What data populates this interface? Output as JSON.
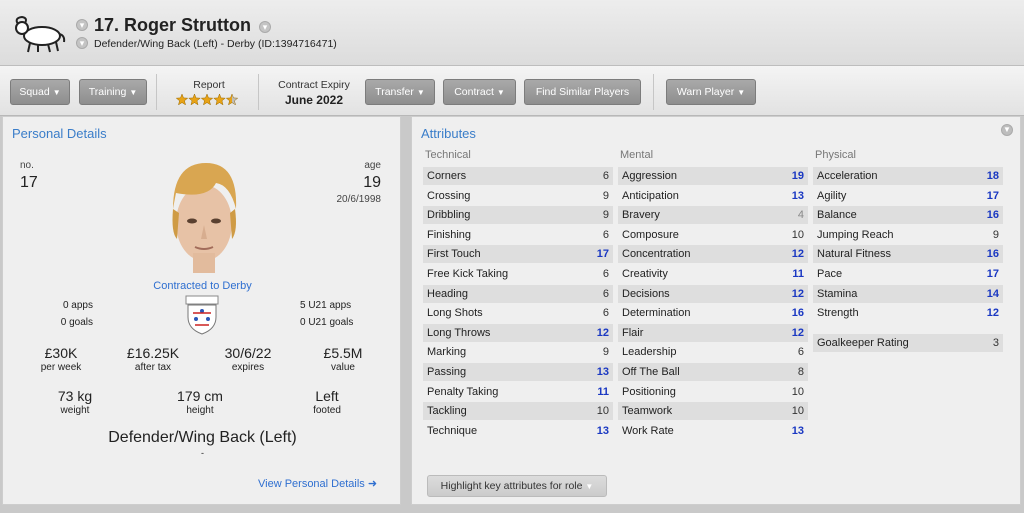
{
  "header": {
    "title": "17. Roger Strutton",
    "subtitle": "Defender/Wing Back (Left) - Derby (ID:1394716471)"
  },
  "toolbar": {
    "squad": "Squad",
    "training": "Training",
    "report_label": "Report",
    "report_stars": 4.5,
    "contract_expiry_label": "Contract Expiry",
    "contract_expiry_value": "June 2022",
    "transfer": "Transfer",
    "contract": "Contract",
    "find_similar": "Find Similar Players",
    "warn_player": "Warn Player"
  },
  "personal": {
    "title": "Personal Details",
    "no_label": "no.",
    "no_value": "17",
    "age_label": "age",
    "age_value": "19",
    "dob": "20/6/1998",
    "contracted": "Contracted to Derby",
    "apps": "0 apps",
    "goals": "0 goals",
    "u21_apps": "5 U21 apps",
    "u21_goals": "0 U21 goals",
    "wage": "£30K",
    "wage_label": "per week",
    "after_tax": "£16.25K",
    "after_tax_label": "after tax",
    "expires": "30/6/22",
    "expires_label": "expires",
    "value": "£5.5M",
    "value_label": "value",
    "weight": "73 kg",
    "weight_label": "weight",
    "height": "179 cm",
    "height_label": "height",
    "foot": "Left",
    "foot_label": "footed",
    "position": "Defender/Wing Back (Left)",
    "position_sub": "-",
    "view_link": "View Personal Details"
  },
  "attributes": {
    "title": "Attributes",
    "highlight_button": "Highlight key attributes for role",
    "technical": {
      "header": "Technical",
      "rows": [
        {
          "name": "Corners",
          "value": "6"
        },
        {
          "name": "Crossing",
          "value": "9"
        },
        {
          "name": "Dribbling",
          "value": "9"
        },
        {
          "name": "Finishing",
          "value": "6"
        },
        {
          "name": "First Touch",
          "value": "17"
        },
        {
          "name": "Free Kick Taking",
          "value": "6"
        },
        {
          "name": "Heading",
          "value": "6"
        },
        {
          "name": "Long Shots",
          "value": "6"
        },
        {
          "name": "Long Throws",
          "value": "12"
        },
        {
          "name": "Marking",
          "value": "9"
        },
        {
          "name": "Passing",
          "value": "13"
        },
        {
          "name": "Penalty Taking",
          "value": "11"
        },
        {
          "name": "Tackling",
          "value": "10"
        },
        {
          "name": "Technique",
          "value": "13"
        }
      ]
    },
    "mental": {
      "header": "Mental",
      "rows": [
        {
          "name": "Aggression",
          "value": "19"
        },
        {
          "name": "Anticipation",
          "value": "13"
        },
        {
          "name": "Bravery",
          "value": "4"
        },
        {
          "name": "Composure",
          "value": "10"
        },
        {
          "name": "Concentration",
          "value": "12"
        },
        {
          "name": "Creativity",
          "value": "11"
        },
        {
          "name": "Decisions",
          "value": "12"
        },
        {
          "name": "Determination",
          "value": "16"
        },
        {
          "name": "Flair",
          "value": "12"
        },
        {
          "name": "Leadership",
          "value": "6"
        },
        {
          "name": "Off The Ball",
          "value": "8"
        },
        {
          "name": "Positioning",
          "value": "10"
        },
        {
          "name": "Teamwork",
          "value": "10"
        },
        {
          "name": "Work Rate",
          "value": "13"
        }
      ]
    },
    "physical": {
      "header": "Physical",
      "rows": [
        {
          "name": "Acceleration",
          "value": "18"
        },
        {
          "name": "Agility",
          "value": "17"
        },
        {
          "name": "Balance",
          "value": "16"
        },
        {
          "name": "Jumping Reach",
          "value": "9"
        },
        {
          "name": "Natural Fitness",
          "value": "16"
        },
        {
          "name": "Pace",
          "value": "17"
        },
        {
          "name": "Stamina",
          "value": "14"
        },
        {
          "name": "Strength",
          "value": "12"
        }
      ],
      "goalkeeper": {
        "name": "Goalkeeper Rating",
        "value": "3"
      }
    }
  }
}
